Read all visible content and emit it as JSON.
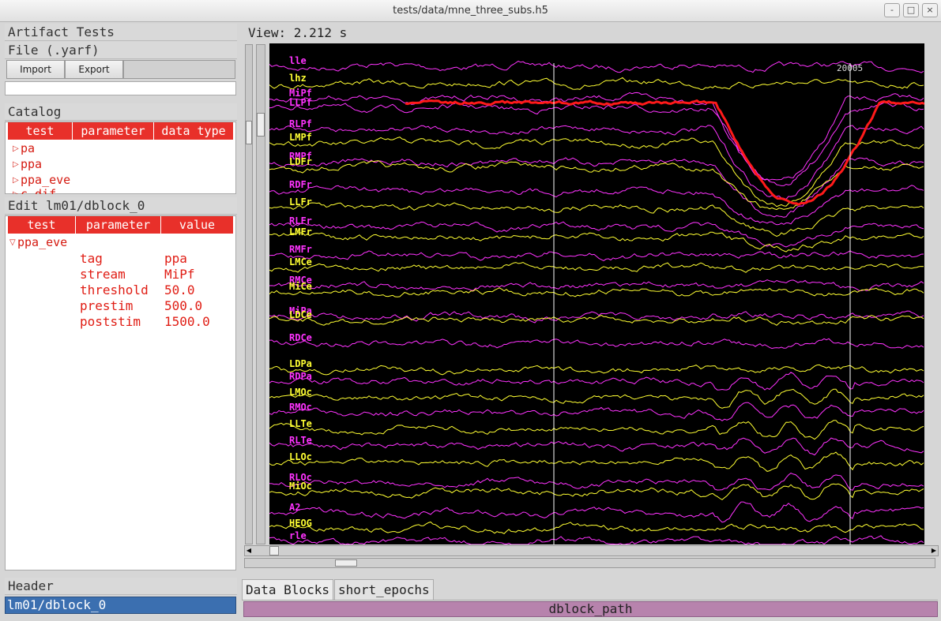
{
  "window": {
    "title": "tests/data/mne_three_subs.h5",
    "buttons": [
      "-",
      "□",
      "×"
    ]
  },
  "artifact": {
    "heading": "Artifact Tests",
    "file_heading": "File (.yarf)",
    "import_label": "Import",
    "export_label": "Export",
    "file_input_value": ""
  },
  "catalog": {
    "heading": "Catalog",
    "columns": [
      "test",
      "parameter",
      "data type"
    ],
    "items": [
      "pa",
      "ppa",
      "ppa_eve",
      "c dif"
    ]
  },
  "edit": {
    "heading": "Edit lm01/dblock_0",
    "columns": [
      "test",
      "parameter",
      "value"
    ],
    "item": "ppa_eve",
    "params": [
      {
        "key": "tag",
        "value": "ppa"
      },
      {
        "key": "stream",
        "value": "MiPf"
      },
      {
        "key": "threshold",
        "value": "50.0"
      },
      {
        "key": "prestim",
        "value": "500.0"
      },
      {
        "key": "poststim",
        "value": "1500.0"
      }
    ]
  },
  "header": {
    "heading": "Header",
    "selected": "lm01/dblock_0"
  },
  "view": {
    "label": "View: 2.212 s",
    "marker_label": "20005",
    "channels": [
      {
        "name": "lle",
        "color": "#ff33ff"
      },
      {
        "name": "lhz",
        "color": "#ffff33"
      },
      {
        "name": "MiPf",
        "color": "#ff33ff"
      },
      {
        "name": "LLPf",
        "color": "#ff33ff"
      },
      {
        "name": "RLPf",
        "color": "#ff33ff"
      },
      {
        "name": "LMPf",
        "color": "#ffff33"
      },
      {
        "name": "RMPf",
        "color": "#ff33ff"
      },
      {
        "name": "LDFr",
        "color": "#ffff33"
      },
      {
        "name": "RDFr",
        "color": "#ff33ff"
      },
      {
        "name": "LLFr",
        "color": "#ffff33"
      },
      {
        "name": "RLFr",
        "color": "#ff33ff"
      },
      {
        "name": "LMFr",
        "color": "#ffff33"
      },
      {
        "name": "RMFr",
        "color": "#ff33ff"
      },
      {
        "name": "LMCe",
        "color": "#ffff33"
      },
      {
        "name": "RMCe",
        "color": "#ff33ff"
      },
      {
        "name": "MiCe",
        "color": "#ffff33"
      },
      {
        "name": "MiPa",
        "color": "#ff33ff"
      },
      {
        "name": "LDCe",
        "color": "#ffff33"
      },
      {
        "name": "RDCe",
        "color": "#ff33ff"
      },
      {
        "name": "LDPa",
        "color": "#ffff33"
      },
      {
        "name": "RDPa",
        "color": "#ff33ff"
      },
      {
        "name": "LMOc",
        "color": "#ffff33"
      },
      {
        "name": "RMOc",
        "color": "#ff33ff"
      },
      {
        "name": "LLTe",
        "color": "#ffff33"
      },
      {
        "name": "RLTe",
        "color": "#ff33ff"
      },
      {
        "name": "LLOc",
        "color": "#ffff33"
      },
      {
        "name": "RLOc",
        "color": "#ff33ff"
      },
      {
        "name": "MiOc",
        "color": "#ffff33"
      },
      {
        "name": "A2",
        "color": "#ff33ff"
      },
      {
        "name": "HEOG",
        "color": "#ffff33"
      },
      {
        "name": "rle",
        "color": "#ff33ff"
      }
    ]
  },
  "tabs": [
    "Data Blocks",
    "short_epochs"
  ],
  "dblock_path": "dblock_path"
}
